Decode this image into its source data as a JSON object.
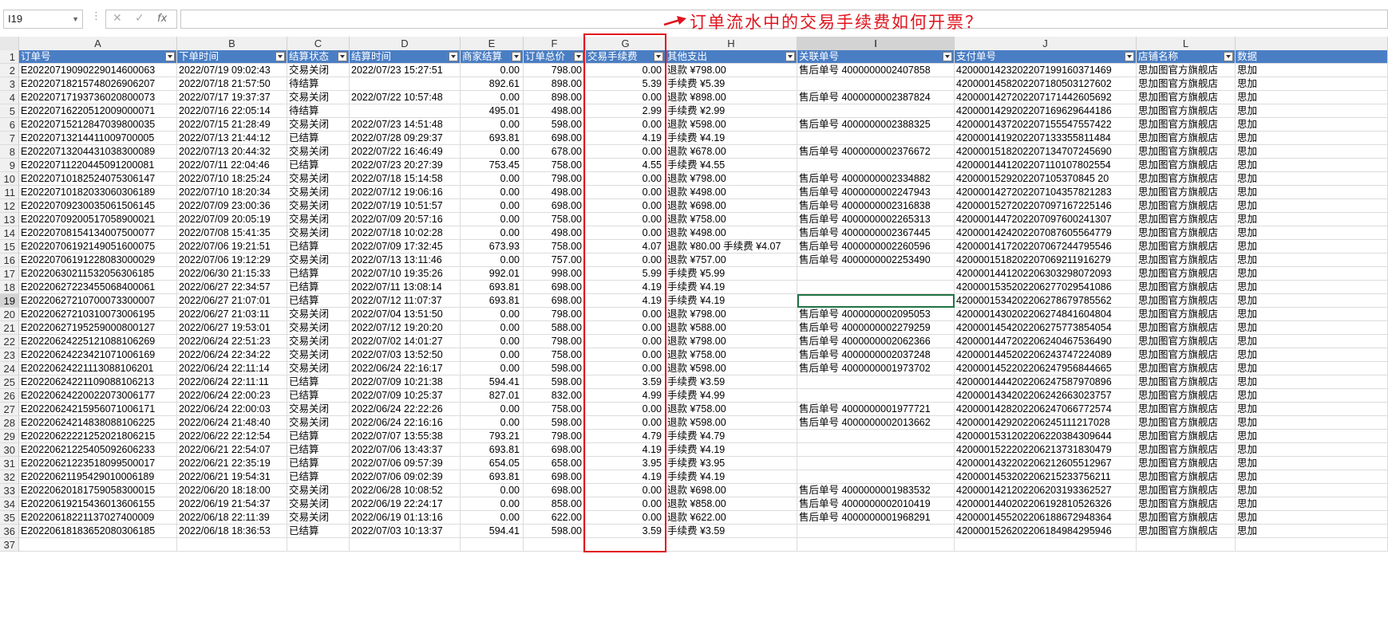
{
  "formula_bar": {
    "name_box": "I19",
    "cancel_icon": "✕",
    "enter_icon": "✓",
    "fx_label": "fx",
    "formula_value": ""
  },
  "annotation": {
    "text": "订单流水中的交易手续费如何开票？",
    "color": "#e0141e"
  },
  "column_letters": [
    "A",
    "B",
    "C",
    "D",
    "E",
    "F",
    "G",
    "H",
    "I",
    "J",
    "L",
    ""
  ],
  "headers": [
    "订单号",
    "下单时间",
    "结算状态",
    "结算时间",
    "商家结算",
    "订单总价",
    "交易手续费",
    "其他支出",
    "关联单号",
    "支付单号",
    "店铺名称",
    "数据"
  ],
  "rows": [
    [
      "1",
      "",
      "",
      "",
      "",
      "",
      "",
      "",
      "",
      "",
      "",
      ""
    ],
    [
      "2",
      "E20220719090229014600063",
      "2022/07/19 09:02:43",
      "交易关闭",
      "2022/07/23 15:27:51",
      "0.00",
      "798.00",
      "0.00",
      "退款 ¥798.00",
      "售后单号 4000000002407858",
      "4200001423202207199160371469",
      "思加图官方旗舰店",
      "思加"
    ],
    [
      "3",
      "E20220718215748026906207",
      "2022/07/18 21:57:50",
      "待结算",
      "",
      "892.61",
      "898.00",
      "5.39",
      "手续费 ¥5.39",
      "",
      "4200001458202207180503127602",
      "思加图官方旗舰店",
      "思加"
    ],
    [
      "4",
      "E20220717193736020800073",
      "2022/07/17 19:37:37",
      "交易关闭",
      "2022/07/22 10:57:48",
      "0.00",
      "898.00",
      "0.00",
      "退款 ¥898.00",
      "售后单号 4000000002387824",
      "4200001427202207171442605692",
      "思加图官方旗舰店",
      "思加"
    ],
    [
      "5",
      "E20220716220512009000071",
      "2022/07/16 22:05:14",
      "待结算",
      "",
      "495.01",
      "498.00",
      "2.99",
      "手续费 ¥2.99",
      "",
      "4200001429202207169629644186",
      "思加图官方旗舰店",
      "思加"
    ],
    [
      "6",
      "E20220715212847039800035",
      "2022/07/15 21:28:49",
      "交易关闭",
      "2022/07/23 14:51:48",
      "0.00",
      "598.00",
      "0.00",
      "退款 ¥598.00",
      "售后单号 4000000002388325",
      "4200001437202207155547557422",
      "思加图官方旗舰店",
      "思加"
    ],
    [
      "7",
      "E20220713214411009700005",
      "2022/07/13 21:44:12",
      "已结算",
      "2022/07/28 09:29:37",
      "693.81",
      "698.00",
      "4.19",
      "手续费 ¥4.19",
      "",
      "4200001419202207133355811484",
      "思加图官方旗舰店",
      "思加"
    ],
    [
      "8",
      "E20220713204431038300089",
      "2022/07/13 20:44:32",
      "交易关闭",
      "2022/07/22 16:46:49",
      "0.00",
      "678.00",
      "0.00",
      "退款 ¥678.00",
      "售后单号 4000000002376672",
      "4200001518202207134707245690",
      "思加图官方旗舰店",
      "思加"
    ],
    [
      "9",
      "E20220711220445091200081",
      "2022/07/11 22:04:46",
      "已结算",
      "2022/07/23 20:27:39",
      "753.45",
      "758.00",
      "4.55",
      "手续费 ¥4.55",
      "",
      "4200001441202207110107802554",
      "思加图官方旗舰店",
      "思加"
    ],
    [
      "10",
      "E20220710182524075306147",
      "2022/07/10 18:25:24",
      "交易关闭",
      "2022/07/18 15:14:58",
      "0.00",
      "798.00",
      "0.00",
      "退款 ¥798.00",
      "售后单号 4000000002334882",
      "4200001529202207105370845 20",
      "思加图官方旗舰店",
      "思加"
    ],
    [
      "11",
      "E20220710182033060306189",
      "2022/07/10 18:20:34",
      "交易关闭",
      "2022/07/12 19:06:16",
      "0.00",
      "498.00",
      "0.00",
      "退款 ¥498.00",
      "售后单号 4000000002247943",
      "4200001427202207104357821283",
      "思加图官方旗舰店",
      "思加"
    ],
    [
      "12",
      "E20220709230035061506145",
      "2022/07/09 23:00:36",
      "交易关闭",
      "2022/07/19 10:51:57",
      "0.00",
      "698.00",
      "0.00",
      "退款 ¥698.00",
      "售后单号 4000000002316838",
      "4200001527202207097167225146",
      "思加图官方旗舰店",
      "思加"
    ],
    [
      "13",
      "E20220709200517058900021",
      "2022/07/09 20:05:19",
      "交易关闭",
      "2022/07/09 20:57:16",
      "0.00",
      "758.00",
      "0.00",
      "退款 ¥758.00",
      "售后单号 4000000002265313",
      "4200001447202207097600241307",
      "思加图官方旗舰店",
      "思加"
    ],
    [
      "14",
      "E20220708154134007500077",
      "2022/07/08 15:41:35",
      "交易关闭",
      "2022/07/18 10:02:28",
      "0.00",
      "498.00",
      "0.00",
      "退款 ¥498.00",
      "售后单号 4000000002367445",
      "4200001424202207087605564779",
      "思加图官方旗舰店",
      "思加"
    ],
    [
      "15",
      "E20220706192149051600075",
      "2022/07/06 19:21:51",
      "已结算",
      "2022/07/09 17:32:45",
      "673.93",
      "758.00",
      "4.07",
      "退款 ¥80.00 手续费 ¥4.07",
      "售后单号 4000000002260596",
      "4200001417202207067244795546",
      "思加图官方旗舰店",
      "思加"
    ],
    [
      "16",
      "E20220706191228083000029",
      "2022/07/06 19:12:29",
      "交易关闭",
      "2022/07/13 13:11:46",
      "0.00",
      "757.00",
      "0.00",
      "退款 ¥757.00",
      "售后单号 4000000002253490",
      "4200001518202207069211916279",
      "思加图官方旗舰店",
      "思加"
    ],
    [
      "17",
      "E20220630211532056306185",
      "2022/06/30 21:15:33",
      "已结算",
      "2022/07/10 19:35:26",
      "992.01",
      "998.00",
      "5.99",
      "手续费 ¥5.99",
      "",
      "4200001441202206303298072093",
      "思加图官方旗舰店",
      "思加"
    ],
    [
      "18",
      "E20220627223455068400061",
      "2022/06/27 22:34:57",
      "已结算",
      "2022/07/11 13:08:14",
      "693.81",
      "698.00",
      "4.19",
      "手续费 ¥4.19",
      "",
      "4200001535202206277029541086",
      "思加图官方旗舰店",
      "思加"
    ],
    [
      "19",
      "E20220627210700073300007",
      "2022/06/27 21:07:01",
      "已结算",
      "2022/07/12 11:07:37",
      "693.81",
      "698.00",
      "4.19",
      "手续费 ¥4.19",
      "",
      "4200001534202206278679785562",
      "思加图官方旗舰店",
      "思加"
    ],
    [
      "20",
      "E20220627210310073006195",
      "2022/06/27 21:03:11",
      "交易关闭",
      "2022/07/04 13:51:50",
      "0.00",
      "798.00",
      "0.00",
      "退款 ¥798.00",
      "售后单号 4000000002095053",
      "4200001430202206274841604804",
      "思加图官方旗舰店",
      "思加"
    ],
    [
      "21",
      "E20220627195259000800127",
      "2022/06/27 19:53:01",
      "交易关闭",
      "2022/07/12 19:20:20",
      "0.00",
      "588.00",
      "0.00",
      "退款 ¥588.00",
      "售后单号 4000000002279259",
      "4200001454202206275773854054",
      "思加图官方旗舰店",
      "思加"
    ],
    [
      "22",
      "E20220624225121088106269",
      "2022/06/24 22:51:23",
      "交易关闭",
      "2022/07/02 14:01:27",
      "0.00",
      "798.00",
      "0.00",
      "退款 ¥798.00",
      "售后单号 4000000002062366",
      "4200001447202206240467536490",
      "思加图官方旗舰店",
      "思加"
    ],
    [
      "23",
      "E20220624223421071006169",
      "2022/06/24 22:34:22",
      "交易关闭",
      "2022/07/03 13:52:50",
      "0.00",
      "758.00",
      "0.00",
      "退款 ¥758.00",
      "售后单号 4000000002037248",
      "4200001445202206243747224089",
      "思加图官方旗舰店",
      "思加"
    ],
    [
      "24",
      "E20220624221113088106201",
      "2022/06/24 22:11:14",
      "交易关闭",
      "2022/06/24 22:16:17",
      "0.00",
      "598.00",
      "0.00",
      "退款 ¥598.00",
      "售后单号 4000000001973702",
      "4200001452202206247956844665",
      "思加图官方旗舰店",
      "思加"
    ],
    [
      "25",
      "E20220624221109088106213",
      "2022/06/24 22:11:11",
      "已结算",
      "2022/07/09 10:21:38",
      "594.41",
      "598.00",
      "3.59",
      "手续费 ¥3.59",
      "",
      "4200001444202206247587970896",
      "思加图官方旗舰店",
      "思加"
    ],
    [
      "26",
      "E20220624220022073006177",
      "2022/06/24 22:00:23",
      "已结算",
      "2022/07/09 10:25:37",
      "827.01",
      "832.00",
      "4.99",
      "手续费 ¥4.99",
      "",
      "4200001434202206242663023757",
      "思加图官方旗舰店",
      "思加"
    ],
    [
      "27",
      "E20220624215956071006171",
      "2022/06/24 22:00:03",
      "交易关闭",
      "2022/06/24 22:22:26",
      "0.00",
      "758.00",
      "0.00",
      "退款 ¥758.00",
      "售后单号 4000000001977721",
      "4200001428202206247066772574",
      "思加图官方旗舰店",
      "思加"
    ],
    [
      "28",
      "E20220624214838088106225",
      "2022/06/24 21:48:40",
      "交易关闭",
      "2022/06/24 22:16:16",
      "0.00",
      "598.00",
      "0.00",
      "退款 ¥598.00",
      "售后单号 4000000002013662",
      "4200001429202206245111217028",
      "思加图官方旗舰店",
      "思加"
    ],
    [
      "29",
      "E20220622221252021806215",
      "2022/06/22 22:12:54",
      "已结算",
      "2022/07/07 13:55:38",
      "793.21",
      "798.00",
      "4.79",
      "手续费 ¥4.79",
      "",
      "4200001531202206220384309644",
      "思加图官方旗舰店",
      "思加"
    ],
    [
      "30",
      "E20220621225405092606233",
      "2022/06/21 22:54:07",
      "已结算",
      "2022/07/06 13:43:37",
      "693.81",
      "698.00",
      "4.19",
      "手续费 ¥4.19",
      "",
      "4200001522202206213731830479",
      "思加图官方旗舰店",
      "思加"
    ],
    [
      "31",
      "E20220621223518099500017",
      "2022/06/21 22:35:19",
      "已结算",
      "2022/07/06 09:57:39",
      "654.05",
      "658.00",
      "3.95",
      "手续费 ¥3.95",
      "",
      "4200001432202206212605512967",
      "思加图官方旗舰店",
      "思加"
    ],
    [
      "32",
      "E20220621195429010006189",
      "2022/06/21 19:54:31",
      "已结算",
      "2022/07/06 09:02:39",
      "693.81",
      "698.00",
      "4.19",
      "手续费 ¥4.19",
      "",
      "4200001453202206215233756211",
      "思加图官方旗舰店",
      "思加"
    ],
    [
      "33",
      "E20220620181759058300015",
      "2022/06/20 18:18:00",
      "交易关闭",
      "2022/06/28 10:08:52",
      "0.00",
      "698.00",
      "0.00",
      "退款 ¥698.00",
      "售后单号 4000000001983532",
      "4200001421202206203193362527",
      "思加图官方旗舰店",
      "思加"
    ],
    [
      "34",
      "E20220619215436013606155",
      "2022/06/19 21:54:37",
      "交易关闭",
      "2022/06/19 22:24:17",
      "0.00",
      "858.00",
      "0.00",
      "退款 ¥858.00",
      "售后单号 4000000002010419",
      "4200001440202206192810526326",
      "思加图官方旗舰店",
      "思加"
    ],
    [
      "35",
      "E20220618221137027400009",
      "2022/06/18 22:11:39",
      "交易关闭",
      "2022/06/19 01:13:16",
      "0.00",
      "622.00",
      "0.00",
      "退款 ¥622.00",
      "售后单号 4000000001968291",
      "4200001455202206188672948364",
      "思加图官方旗舰店",
      "思加"
    ],
    [
      "36",
      "E20220618183652080306185",
      "2022/06/18 18:36:53",
      "已结算",
      "2022/07/03 10:13:37",
      "594.41",
      "598.00",
      "3.59",
      "手续费 ¥3.59",
      "",
      "4200001526202206184984295946",
      "思加图官方旗舰店",
      "思加"
    ],
    [
      "37",
      "",
      "",
      "",
      "",
      "",
      "",
      "",
      "",
      "",
      "",
      "",
      ""
    ]
  ],
  "selected_cell": "I19"
}
